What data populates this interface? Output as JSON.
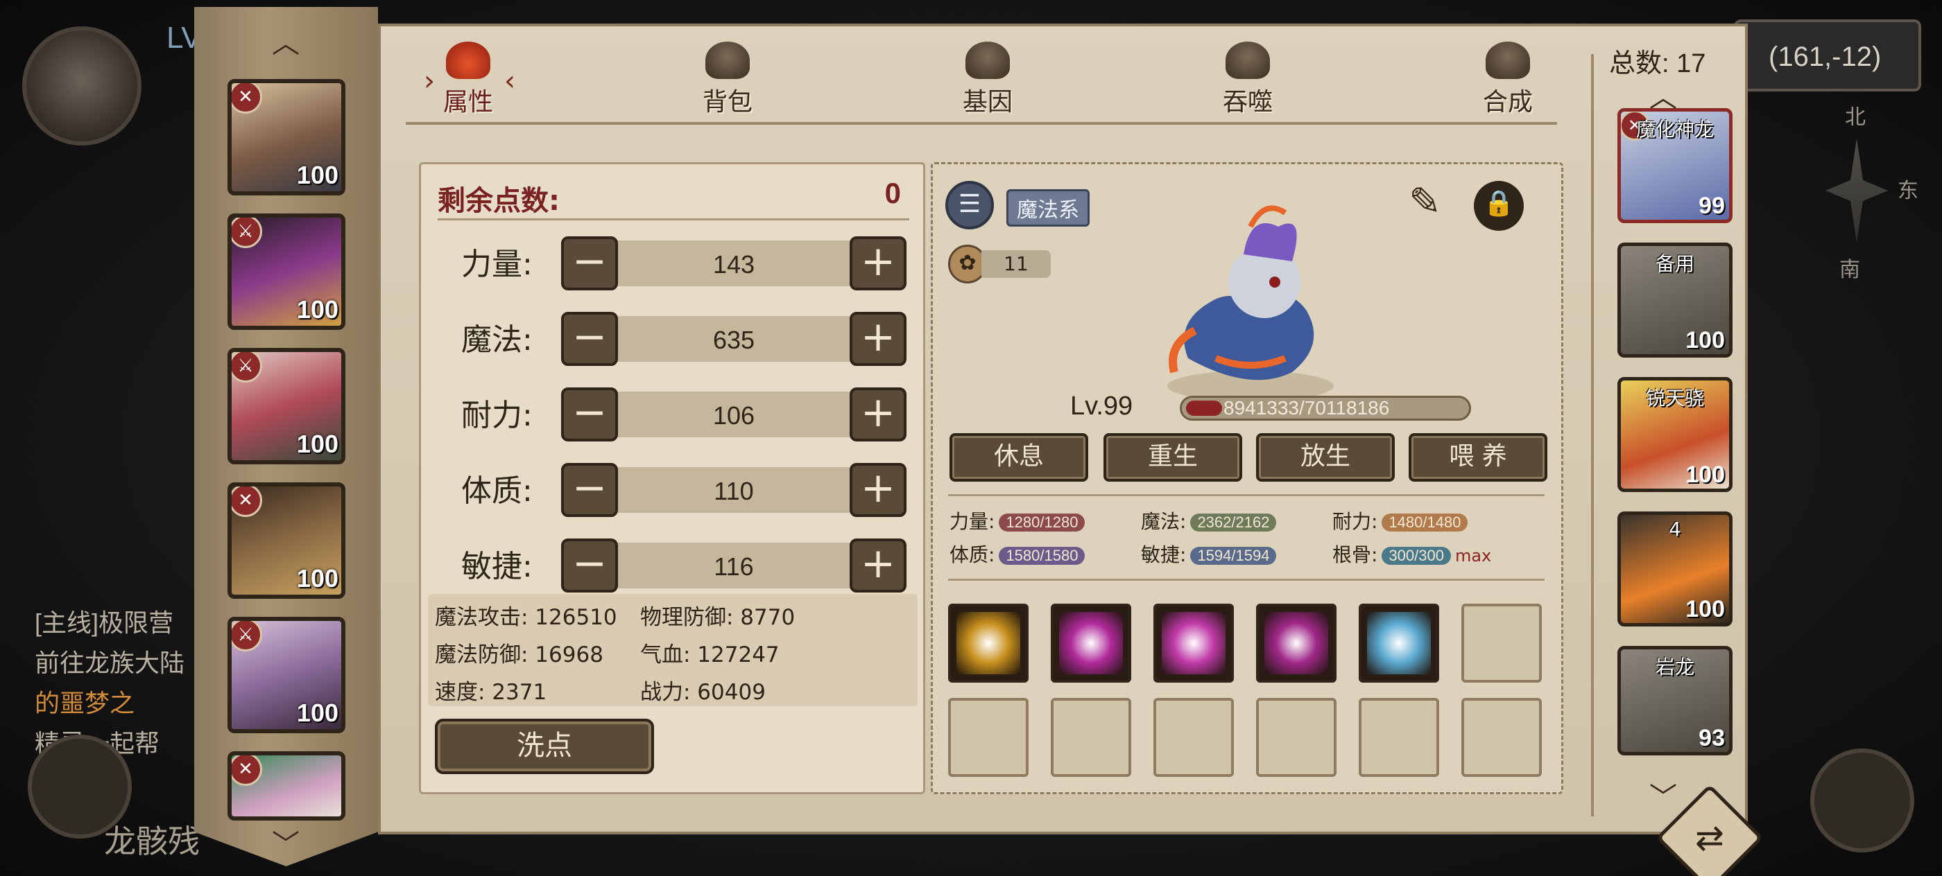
{
  "world": {
    "lv_text": "LV",
    "coords": "(161,-12)",
    "compass": {
      "n": "北",
      "s": "南",
      "e": "东"
    },
    "quest_lines": [
      "[主线]极限营",
      "前往龙族大陆",
      "的噩梦之",
      "精灵一起帮"
    ],
    "bottom_text": "龙骸残"
  },
  "tabs": [
    {
      "label": "属性",
      "icon": "fire-icon",
      "active": true
    },
    {
      "label": "背包",
      "icon": "bag-icon",
      "active": false
    },
    {
      "label": "基因",
      "icon": "gene-icon",
      "active": false
    },
    {
      "label": "吞噬",
      "icon": "devour-icon",
      "active": false
    },
    {
      "label": "合成",
      "icon": "fusion-icon",
      "active": false
    }
  ],
  "heroes": [
    {
      "level": "100",
      "tag": "✕"
    },
    {
      "level": "100",
      "tag": "⚔"
    },
    {
      "level": "100",
      "tag": "⚔"
    },
    {
      "level": "100",
      "tag": "✕"
    },
    {
      "level": "100",
      "tag": "⚔"
    },
    {
      "level": "",
      "tag": "✕"
    }
  ],
  "attributes": {
    "remaining_label": "剩余点数:",
    "remaining_value": "0",
    "stats": [
      {
        "label": "力量:",
        "value": "143"
      },
      {
        "label": "魔法:",
        "value": "635"
      },
      {
        "label": "耐力:",
        "value": "106"
      },
      {
        "label": "体质:",
        "value": "110"
      },
      {
        "label": "敏捷:",
        "value": "116"
      }
    ],
    "derived": [
      "魔法攻击: 126510",
      "物理防御: 8770",
      "魔法防御: 16968",
      "气血: 127247",
      "速度: 2371",
      "战力: 60409"
    ],
    "wash_button": "洗点"
  },
  "pet": {
    "type_label": "魔法系",
    "paw_count": "11",
    "level": "Lv.99",
    "hp_text": "8941333/70118186",
    "hp_fraction": 0.1275,
    "actions": [
      "休息",
      "重生",
      "放生",
      "喂 养"
    ],
    "stats": [
      {
        "label": "力量:",
        "value": "1280/1280",
        "color": "#8c4a4a"
      },
      {
        "label": "魔法:",
        "value": "2362/2162",
        "color": "#6e7a5a"
      },
      {
        "label": "耐力:",
        "value": "1480/1480",
        "color": "#b07a4a"
      },
      {
        "label": "体质:",
        "value": "1580/1580",
        "color": "#6e5a8a"
      },
      {
        "label": "敏捷:",
        "value": "1594/1594",
        "color": "#5a6a8a"
      },
      {
        "label": "根骨:",
        "value": "300/300",
        "color": "#4a7a8a",
        "suffix": "max"
      }
    ],
    "skills": [
      {
        "icon": "dragon-emblem-icon",
        "color": "#c8901e",
        "filled": true
      },
      {
        "icon": "magenta-spikes-icon",
        "color": "#b02a9a",
        "filled": true
      },
      {
        "icon": "magenta-orb-icon",
        "color": "#c03aa8",
        "filled": true
      },
      {
        "icon": "magenta-burst-icon",
        "color": "#a02888",
        "filled": true
      },
      {
        "icon": "ice-shatter-icon",
        "color": "#5aa8d0",
        "filled": true
      },
      {
        "icon": "",
        "color": "",
        "filled": false
      },
      {
        "icon": "",
        "color": "",
        "filled": false
      },
      {
        "icon": "",
        "color": "",
        "filled": false
      },
      {
        "icon": "",
        "color": "",
        "filled": false
      },
      {
        "icon": "",
        "color": "",
        "filled": false
      },
      {
        "icon": "",
        "color": "",
        "filled": false
      },
      {
        "icon": "",
        "color": "",
        "filled": false
      }
    ]
  },
  "pet_list": {
    "count_label": "总数: 17",
    "items": [
      {
        "name": "魔化神龙",
        "level": "99",
        "tag": "✕",
        "color": "#8aa0c8"
      },
      {
        "name": "备用",
        "level": "100",
        "tag": "",
        "color": "#7a7468"
      },
      {
        "name": "锐天骁",
        "level": "100",
        "tag": "",
        "color": "#d0b04a"
      },
      {
        "name": "4",
        "level": "100",
        "tag": "",
        "color": "#6a5a48"
      },
      {
        "name": "岩龙",
        "level": "93",
        "tag": "",
        "color": "#7a7468"
      }
    ]
  },
  "colors": {
    "panel": "#dcd1bb",
    "button": "#5a4a38",
    "accent": "#7a2222"
  }
}
